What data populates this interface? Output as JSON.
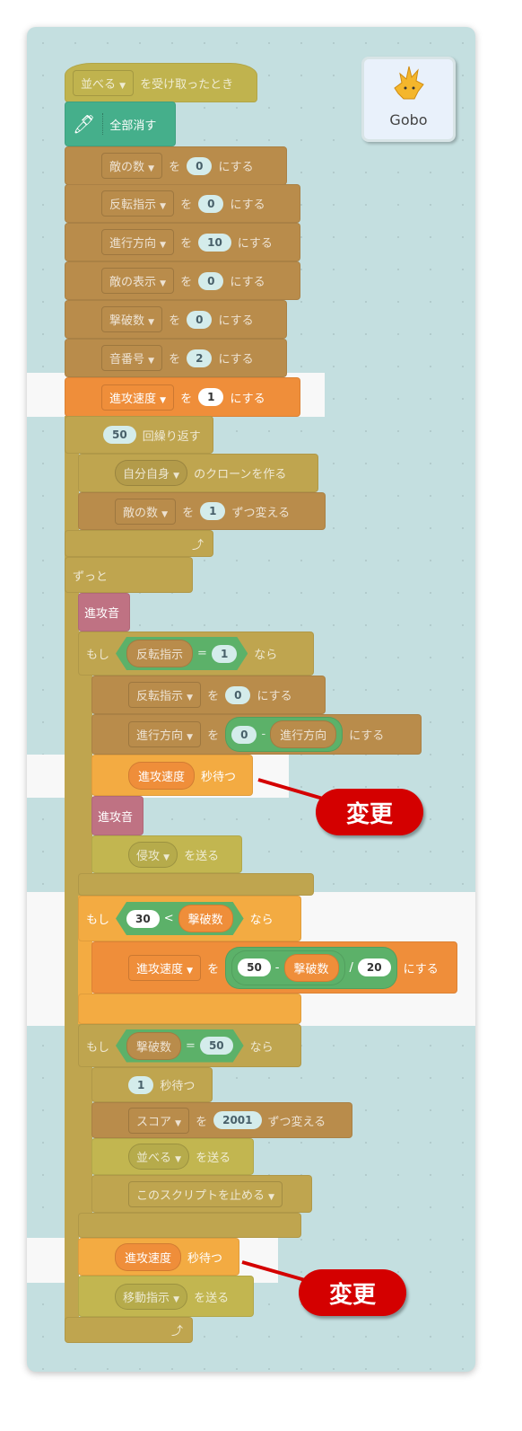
{
  "sprite": {
    "name": "Gobo"
  },
  "hat": {
    "menu": "並べる",
    "text": "を受け取ったとき"
  },
  "pen": {
    "text": "全部消す"
  },
  "sets": [
    {
      "var": "敵の数",
      "wo": "を",
      "value": "0",
      "suffix": "にする"
    },
    {
      "var": "反転指示",
      "wo": "を",
      "value": "0",
      "suffix": "にする"
    },
    {
      "var": "進行方向",
      "wo": "を",
      "value": "10",
      "suffix": "にする"
    },
    {
      "var": "敵の表示",
      "wo": "を",
      "value": "0",
      "suffix": "にする"
    },
    {
      "var": "撃破数",
      "wo": "を",
      "value": "0",
      "suffix": "にする"
    },
    {
      "var": "音番号",
      "wo": "を",
      "value": "2",
      "suffix": "にする"
    },
    {
      "var": "進攻速度",
      "wo": "を",
      "value": "1",
      "suffix": "にする"
    }
  ],
  "repeat": {
    "count": "50",
    "text": "回繰り返す"
  },
  "clone": {
    "menu": "自分自身",
    "text": "のクローンを作る"
  },
  "change1": {
    "var": "敵の数",
    "wo": "を",
    "value": "1",
    "text": "ずつ変える"
  },
  "forever": {
    "text": "ずっと"
  },
  "sound1": {
    "text": "進攻音"
  },
  "if1": {
    "if": "もし",
    "left": "反転指示",
    "op": "=",
    "right": "1",
    "then": "なら"
  },
  "set_flip": {
    "var": "反転指示",
    "wo": "を",
    "value": "0",
    "suffix": "にする"
  },
  "set_dir": {
    "var": "進行方向",
    "wo": "を",
    "a": "0",
    "op": "-",
    "b": "進行方向",
    "suffix": "にする"
  },
  "wait1": {
    "var": "進攻速度",
    "text": "秒待つ"
  },
  "sound2": {
    "text": "進攻音"
  },
  "bc1": {
    "menu": "侵攻",
    "text": "を送る"
  },
  "if2": {
    "if": "もし",
    "left": "30",
    "op": "<",
    "right": "撃破数",
    "then": "なら"
  },
  "set_speed": {
    "var": "進攻速度",
    "wo": "を",
    "a": "50",
    "op1": "-",
    "b": "撃破数",
    "op2": "/",
    "c": "20",
    "suffix": "にする"
  },
  "if3": {
    "if": "もし",
    "left": "撃破数",
    "op": "=",
    "right": "50",
    "then": "なら"
  },
  "wait2": {
    "value": "1",
    "text": "秒待つ"
  },
  "change2": {
    "var": "スコア",
    "wo": "を",
    "value": "2001",
    "text": "ずつ変える"
  },
  "bc2": {
    "menu": "並べる",
    "text": "を送る"
  },
  "stop": {
    "menu": "このスクリプトを止める"
  },
  "wait3": {
    "var": "進攻速度",
    "text": "秒待つ"
  },
  "bc3": {
    "menu": "移動指示",
    "text": "を送る"
  },
  "callouts": [
    {
      "text": "変更"
    },
    {
      "text": "変更"
    }
  ],
  "colors": {
    "callout": "#d40000",
    "highlight_var": "#ef8e3a",
    "highlight_control": "#f3ab42"
  }
}
